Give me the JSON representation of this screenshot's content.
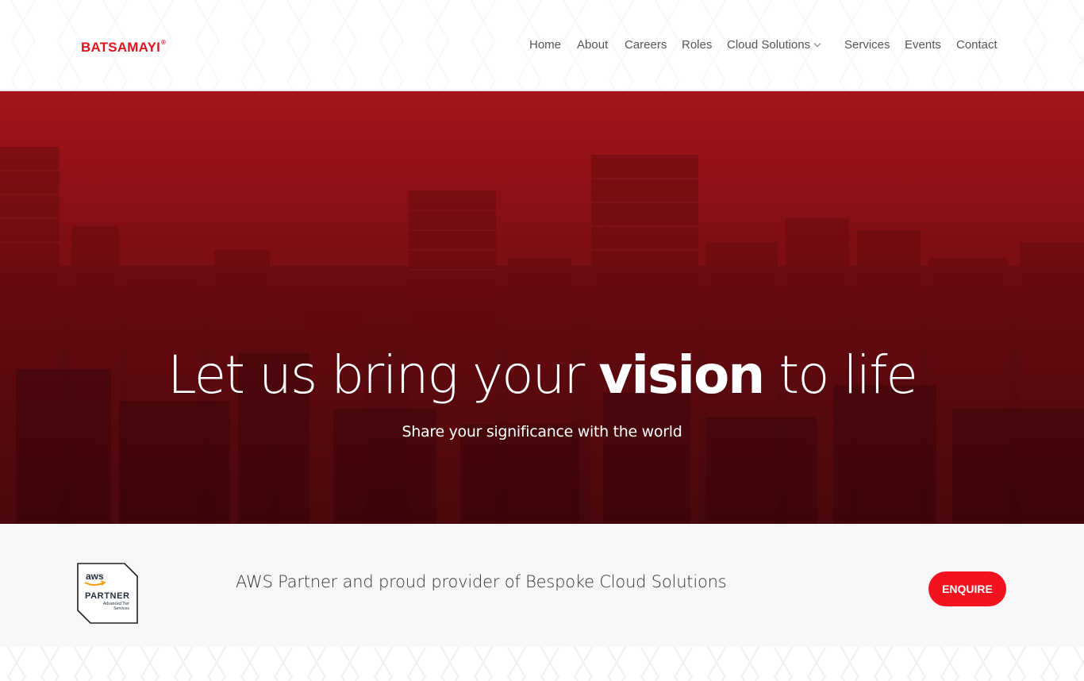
{
  "brand": {
    "name": "BATSAMAYI",
    "mark": "®",
    "color": "#e0141f"
  },
  "nav": {
    "items": [
      {
        "label": "Home"
      },
      {
        "label": "About"
      },
      {
        "label": "Careers"
      },
      {
        "label": "Roles"
      },
      {
        "label": "Cloud Solutions",
        "has_dropdown": true
      },
      {
        "label": "Services"
      },
      {
        "label": "Events"
      },
      {
        "label": "Contact"
      }
    ]
  },
  "hero": {
    "title_before": "Let us bring your ",
    "title_emphasis": "vision",
    "title_after": " to life",
    "subtitle": "Share your significance with the world",
    "slides": 5,
    "active_slide": 3,
    "overlay_color": "#a6141b"
  },
  "partner": {
    "badge": {
      "brand": "aws",
      "title": "PARTNER",
      "line1": "Advanced Tier",
      "line2": "Services"
    },
    "text": "AWS Partner and proud provider of Bespoke Cloud Solutions",
    "button_label": "ENQUIRE",
    "button_color": "#f2131f"
  }
}
